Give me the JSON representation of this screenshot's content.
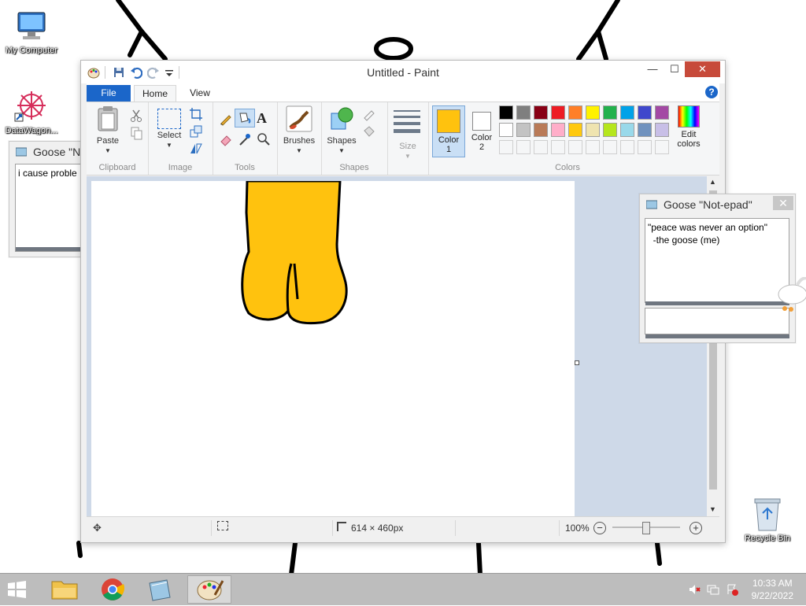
{
  "desktop": {
    "icons": [
      {
        "label": "My Computer"
      },
      {
        "label": "DataWagon..."
      },
      {
        "label": "Recycle Bin"
      }
    ]
  },
  "left_note": {
    "title": "Goose \"N",
    "text": "i cause proble"
  },
  "right_note": {
    "title": "Goose \"Not-epad\"",
    "text": "\"peace was never an option\"\n  -the goose (me)"
  },
  "paint": {
    "title": "Untitled - Paint",
    "tabs": {
      "file": "File",
      "home": "Home",
      "view": "View"
    },
    "groups": {
      "clipboard": {
        "label": "Clipboard",
        "paste": "Paste"
      },
      "image": {
        "label": "Image",
        "select": "Select"
      },
      "tools": {
        "label": "Tools"
      },
      "brushes": {
        "label": "Brushes"
      },
      "shapes": {
        "label": "Shapes",
        "button": "Shapes"
      },
      "size": {
        "label": "Size"
      },
      "colors": {
        "label": "Colors",
        "color1": "Color\n1",
        "color2": "Color\n2",
        "edit": "Edit\ncolors"
      }
    },
    "color1": "#ffc20e",
    "color2": "#ffffff",
    "palette_row1": [
      "#000000",
      "#7f7f7f",
      "#880015",
      "#ed1c24",
      "#ff7f27",
      "#fff200",
      "#22b14c",
      "#00a2e8",
      "#3f48cc",
      "#a349a4"
    ],
    "palette_row2": [
      "#ffffff",
      "#c3c3c3",
      "#b97a57",
      "#ffaec9",
      "#ffc90e",
      "#efe4b0",
      "#b5e61d",
      "#99d9ea",
      "#7092be",
      "#c8bfe7"
    ],
    "status": {
      "dimensions": "614 × 460px",
      "zoom": "100%"
    }
  },
  "taskbar": {
    "time": "10:33 AM",
    "date": "9/22/2022"
  }
}
